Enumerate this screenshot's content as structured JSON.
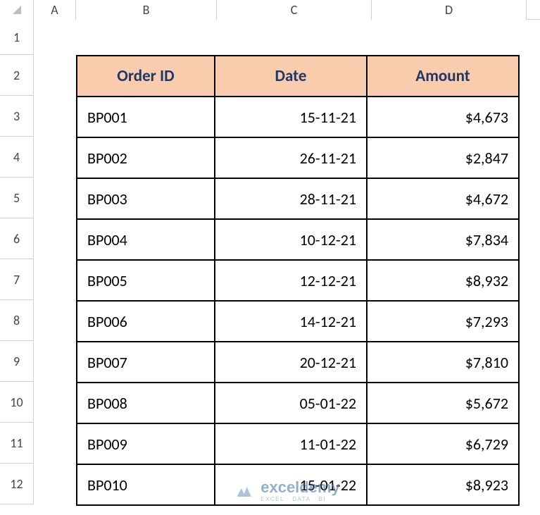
{
  "columns": [
    "A",
    "B",
    "C",
    "D"
  ],
  "rowNumbers": [
    "1",
    "2",
    "3",
    "4",
    "5",
    "6",
    "7",
    "8",
    "9",
    "10",
    "11",
    "12"
  ],
  "headers": {
    "order": "Order ID",
    "date": "Date",
    "amount": "Amount"
  },
  "rows": [
    {
      "order": "BP001",
      "date": "15-11-21",
      "amount": "$4,673"
    },
    {
      "order": "BP002",
      "date": "26-11-21",
      "amount": "$2,847"
    },
    {
      "order": "BP003",
      "date": "28-11-21",
      "amount": "$4,672"
    },
    {
      "order": "BP004",
      "date": "10-12-21",
      "amount": "$7,834"
    },
    {
      "order": "BP005",
      "date": "12-12-21",
      "amount": "$8,932"
    },
    {
      "order": "BP006",
      "date": "14-12-21",
      "amount": "$7,293"
    },
    {
      "order": "BP007",
      "date": "20-12-21",
      "amount": "$7,810"
    },
    {
      "order": "BP008",
      "date": "05-01-22",
      "amount": "$5,672"
    },
    {
      "order": "BP009",
      "date": "11-01-22",
      "amount": "$6,729"
    },
    {
      "order": "BP010",
      "date": "15-01-22",
      "amount": "$8,923"
    }
  ],
  "watermark": {
    "main": "exceldemy",
    "sub": "EXCEL · DATA · BI"
  },
  "chart_data": {
    "type": "table",
    "title": "",
    "columns": [
      "Order ID",
      "Date",
      "Amount"
    ],
    "data": [
      [
        "BP001",
        "15-11-21",
        4673
      ],
      [
        "BP002",
        "26-11-21",
        2847
      ],
      [
        "BP003",
        "28-11-21",
        4672
      ],
      [
        "BP004",
        "10-12-21",
        7834
      ],
      [
        "BP005",
        "12-12-21",
        8932
      ],
      [
        "BP006",
        "14-12-21",
        7293
      ],
      [
        "BP007",
        "20-12-21",
        7810
      ],
      [
        "BP008",
        "05-01-22",
        5672
      ],
      [
        "BP009",
        "11-01-22",
        6729
      ],
      [
        "BP010",
        "15-01-22",
        8923
      ]
    ]
  }
}
